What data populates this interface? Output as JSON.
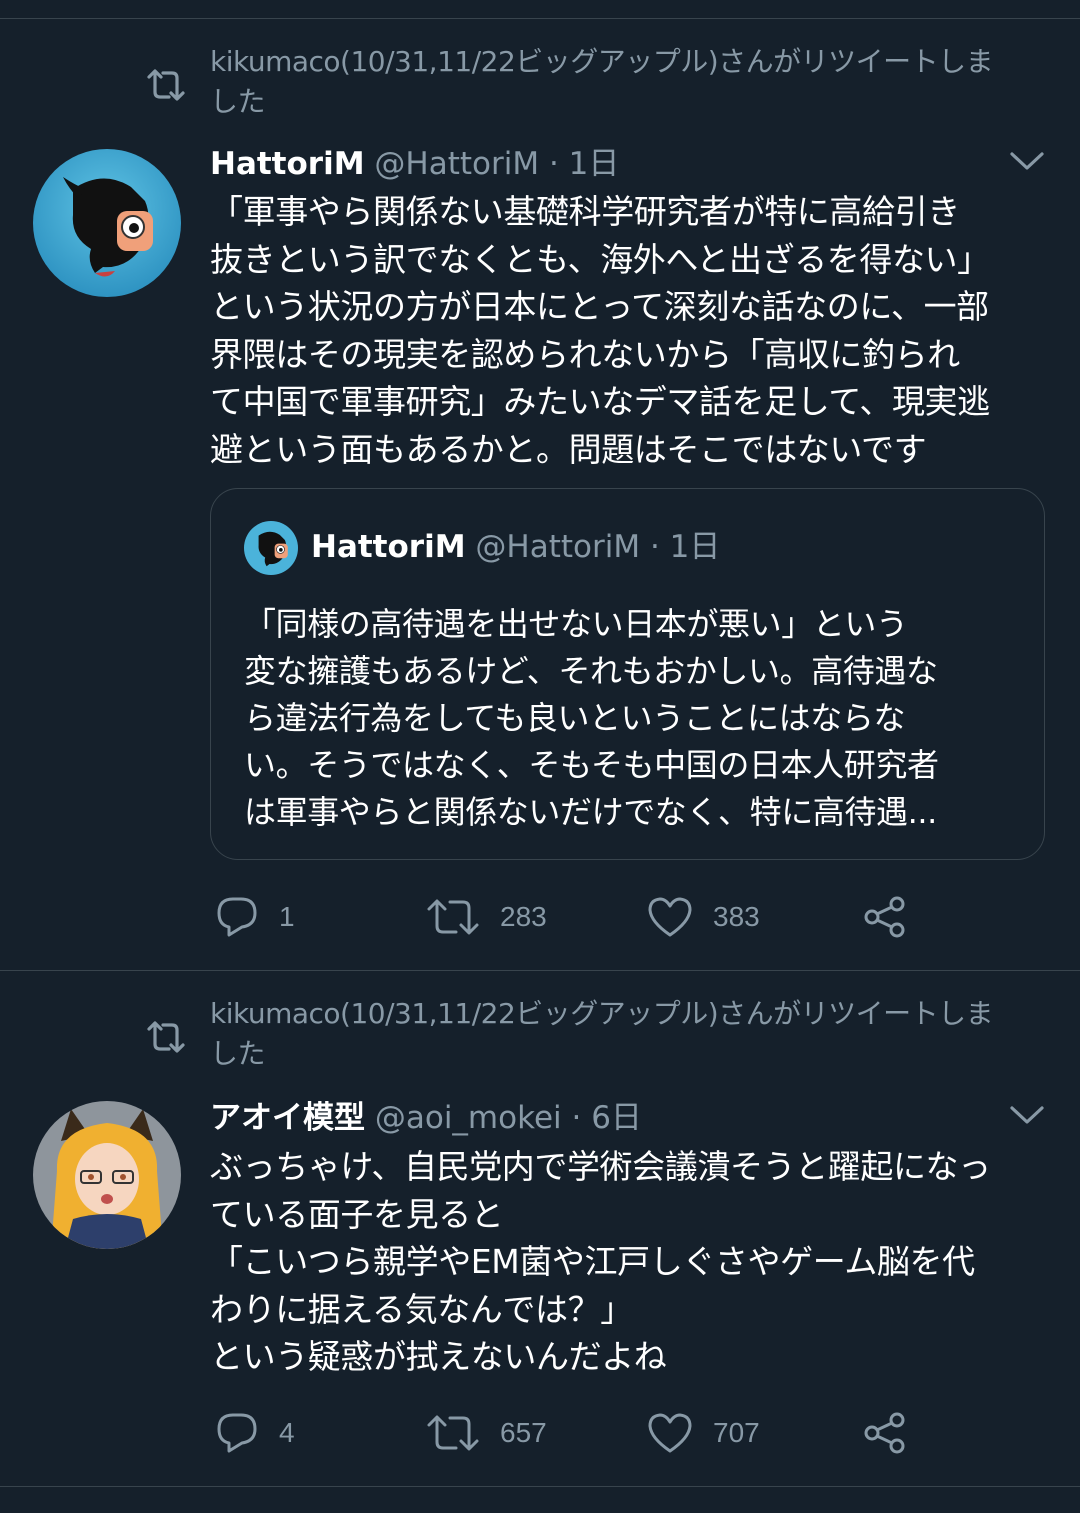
{
  "tweets": [
    {
      "retweet_line1": "kikumaco(10/31,11/22ビッグアップル)さんがリツイートしま",
      "retweet_line2": "した",
      "name": "HattoriM",
      "handle": "@HattoriM",
      "time": "· 1日",
      "body": [
        "「軍事やら関係ない基礎科学研究者が特に高給引き",
        "抜きという訳でなくとも、海外へと出ざるを得ない」",
        "という状況の方が日本にとって深刻な話なのに、一部",
        "界隈はその現実を認められないから「高収に釣られ",
        "て中国で軍事研究」みたいなデマ話を足して、現実逃",
        "避という面もあるかと。問題はそこではないです"
      ],
      "quote": {
        "name": "HattoriM",
        "handle": "@HattoriM",
        "time": "· 1日",
        "body": [
          "「同様の高待遇を出せない日本が悪い」という",
          "変な擁護もあるけど、それもおかしい。高待遇な",
          "ら違法行為をしても良いということにはならな",
          "い。そうではなく、そもそも中国の日本人研究者",
          "は軍事やらと関係ないだけでなく、特に高待遇..."
        ]
      },
      "replies": "1",
      "retweets": "283",
      "likes": "383"
    },
    {
      "retweet_line1": "kikumaco(10/31,11/22ビッグアップル)さんがリツイートしま",
      "retweet_line2": "した",
      "name": "アオイ模型",
      "handle": "@aoi_mokei",
      "time": "· 6日",
      "body": [
        "ぶっちゃけ、自民党内で学術会議潰そうと躍起になっ",
        "ている面子を見ると",
        "「こいつら親学やEM菌や江戸しぐさやゲーム脳を代",
        "わりに据える気なんでは？」",
        "という疑惑が拭えないんだよね"
      ],
      "replies": "4",
      "retweets": "657",
      "likes": "707"
    }
  ],
  "colors": {
    "background": "#15202b",
    "secondary_text": "#8899a6",
    "divider": "#38444d"
  },
  "icons": [
    "retweet-icon",
    "chevron-down-icon",
    "reply-icon",
    "like-icon",
    "share-icon"
  ]
}
